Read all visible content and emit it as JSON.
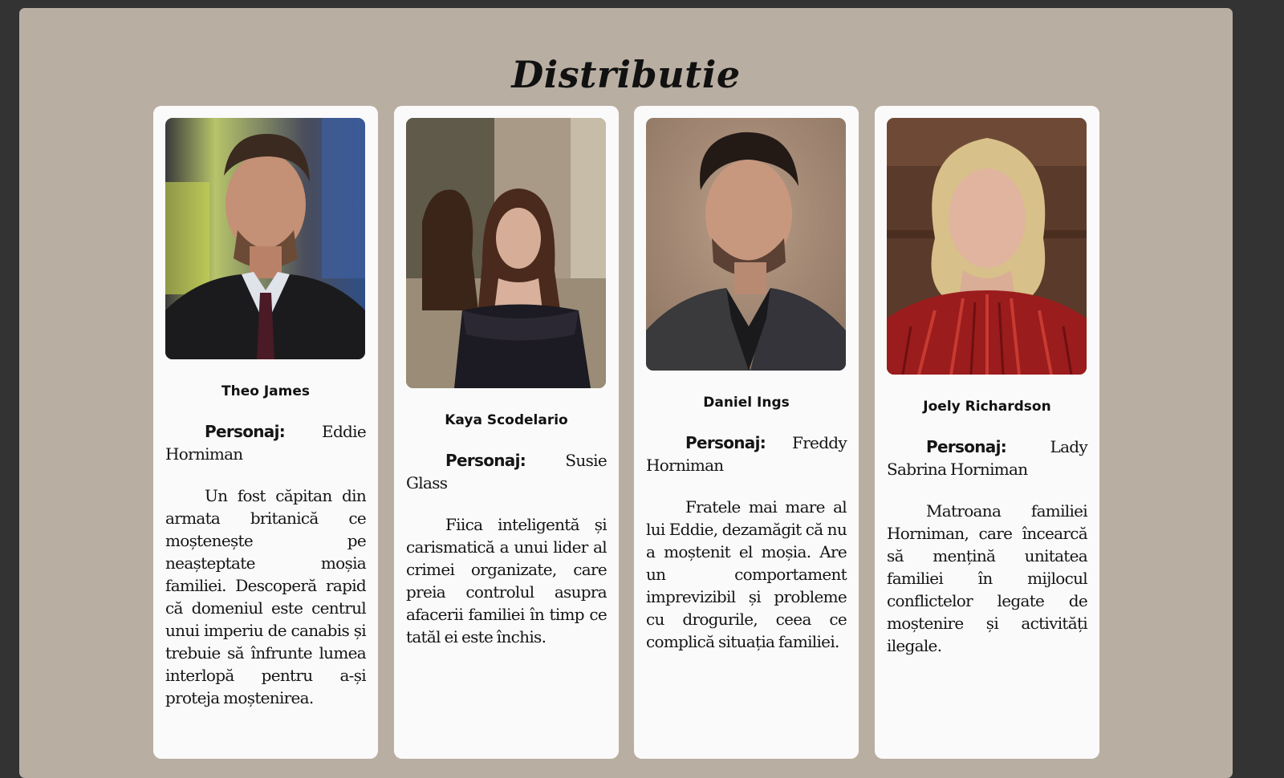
{
  "page": {
    "title": "Distributie"
  },
  "cast": [
    {
      "name": "Theo James",
      "role_label": "Personaj:",
      "character": "Eddie Horniman",
      "description": "Un fost căpitan din armata britanică ce moștenește pe neașteptate moșia familiei. Descoperă rapid că domeniul este centrul unui imperiu de canabis și trebuie să înfrunte lumea interlopă pentru a-și proteja moștenirea.",
      "photo_icon": "portrait-man-suit-icon"
    },
    {
      "name": "Kaya Scodelario",
      "role_label": "Personaj:",
      "character": "Susie Glass",
      "description": "Fiica inteligentă și carismatică a unui lider al crimei organizate, care preia controlul asupra afacerii familiei în timp ce tatăl ei este închis.",
      "photo_icon": "portrait-woman-dark-dress-icon"
    },
    {
      "name": "Daniel Ings",
      "role_label": "Personaj:",
      "character": "Freddy Horniman",
      "description": "Fratele mai mare al lui Eddie, dezamăgit că nu a moștenit el moșia. Are un comportament imprevizibil și probleme cu drogurile, ceea ce complică situația familiei.",
      "photo_icon": "portrait-man-tweed-jacket-icon"
    },
    {
      "name": "Joely Richardson",
      "role_label": "Personaj:",
      "character": "Lady Sabrina Horniman",
      "description": "Matroana familiei Horniman, care încearcă să mențină unitatea familiei în mijlocul conflictelor legate de moștenire și activități ilegale.",
      "photo_icon": "portrait-woman-red-dress-icon"
    }
  ],
  "colors": {
    "background": "#333333",
    "panel": "#b9aea2",
    "card": "#fafafa",
    "text": "#151515"
  }
}
